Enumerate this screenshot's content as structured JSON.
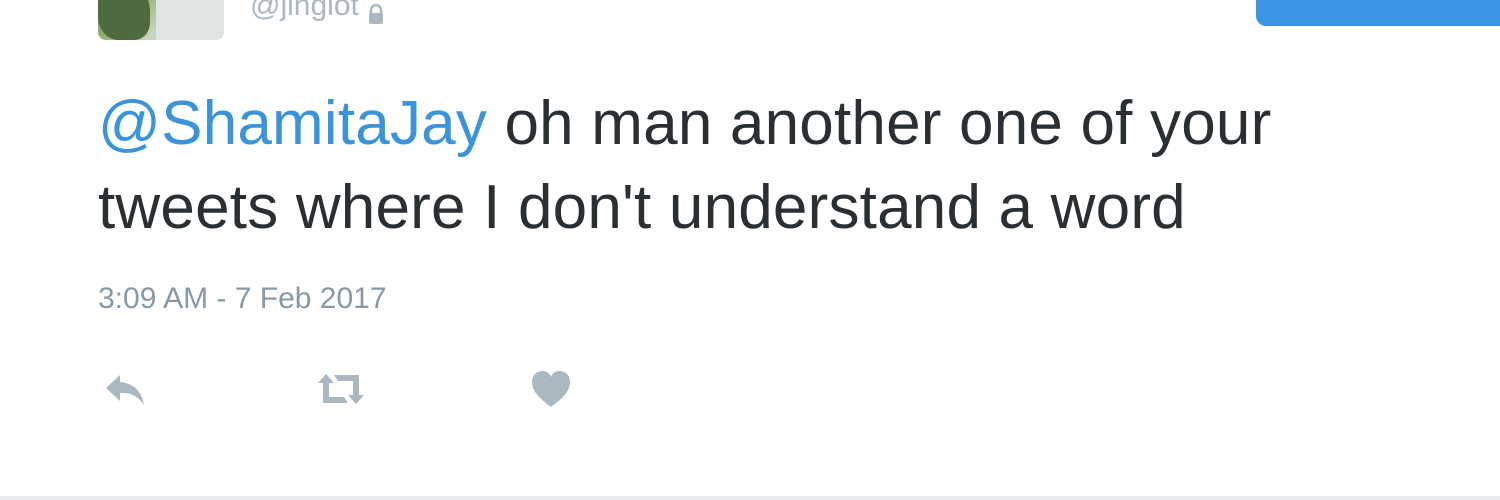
{
  "user": {
    "handle": "@jinglot",
    "protected_icon": "lock-icon",
    "avatar": "profile-photo"
  },
  "follow_button": {
    "label": "",
    "color": "#3b94e4"
  },
  "tweet": {
    "mention": "@ShamitaJay",
    "text": " oh man another one of your tweets where I don't understand a word",
    "timestamp": "3:09 AM - 7 Feb 2017"
  },
  "actions": [
    {
      "icon": "reply-icon"
    },
    {
      "icon": "retweet-icon"
    },
    {
      "icon": "like-heart-icon"
    }
  ],
  "colors": {
    "text": "#292f33",
    "link": "#3b94d9",
    "muted": "#8899a6",
    "icon": "#aab8c2"
  }
}
